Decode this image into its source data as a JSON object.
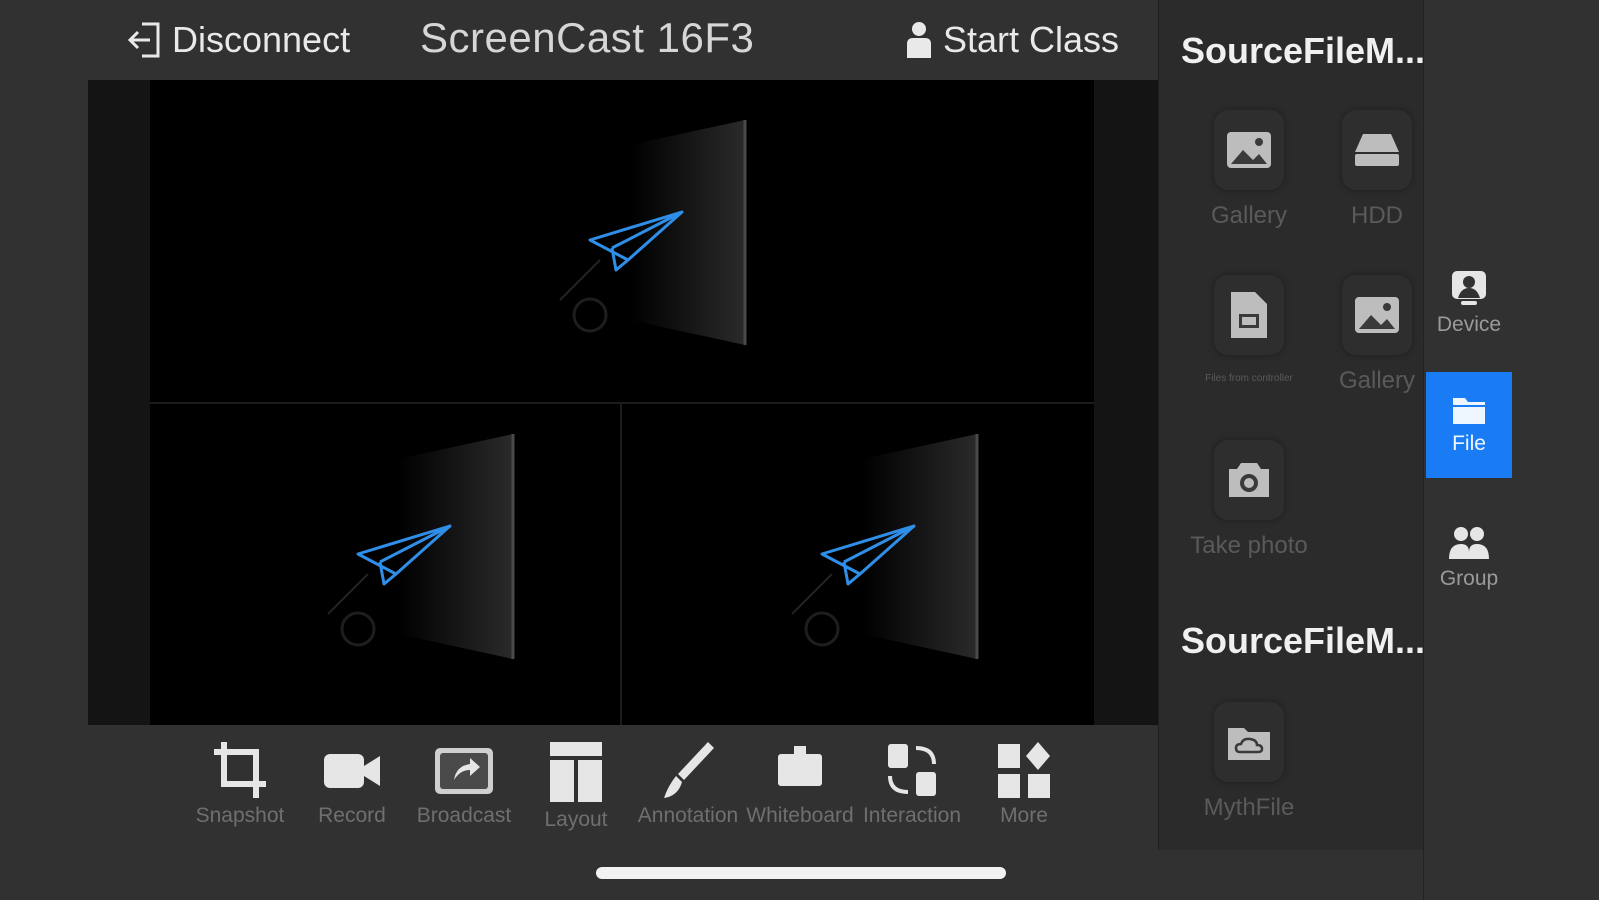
{
  "header": {
    "disconnect_label": "Disconnect",
    "title": "ScreenCast  16F3",
    "start_class_label": "Start Class"
  },
  "toolbar": {
    "tools": [
      {
        "label": "Snapshot",
        "icon": "crop-icon"
      },
      {
        "label": "Record",
        "icon": "video-camera-icon"
      },
      {
        "label": "Broadcast",
        "icon": "share-screen-icon"
      },
      {
        "label": "Layout",
        "icon": "layout-icon"
      },
      {
        "label": "Annotation",
        "icon": "brush-icon"
      },
      {
        "label": "Whiteboard",
        "icon": "whiteboard-icon"
      },
      {
        "label": "Interaction",
        "icon": "interaction-icon"
      },
      {
        "label": "More",
        "icon": "more-grid-icon"
      }
    ]
  },
  "source_panel": {
    "section1_title": "SourceFileM...",
    "section2_title": "SourceFileM...",
    "items": [
      {
        "label": "Gallery",
        "icon": "image-icon"
      },
      {
        "label": "HDD",
        "icon": "hard-drive-icon"
      },
      {
        "label": "Files from controller",
        "icon": "file-screen-icon"
      },
      {
        "label": "Gallery",
        "icon": "image-icon"
      },
      {
        "label": "Take photo",
        "icon": "camera-icon"
      },
      {
        "label": "MythFile",
        "icon": "cloud-folder-icon"
      }
    ]
  },
  "side_nav": {
    "items": [
      {
        "label": "Device",
        "icon": "device-icon",
        "active": false
      },
      {
        "label": "File",
        "icon": "folder-icon",
        "active": true
      },
      {
        "label": "Group",
        "icon": "group-icon",
        "active": false
      }
    ]
  },
  "colors": {
    "accent": "#1a7cf5",
    "background": "#313131",
    "plane": "#2f8fe8"
  }
}
